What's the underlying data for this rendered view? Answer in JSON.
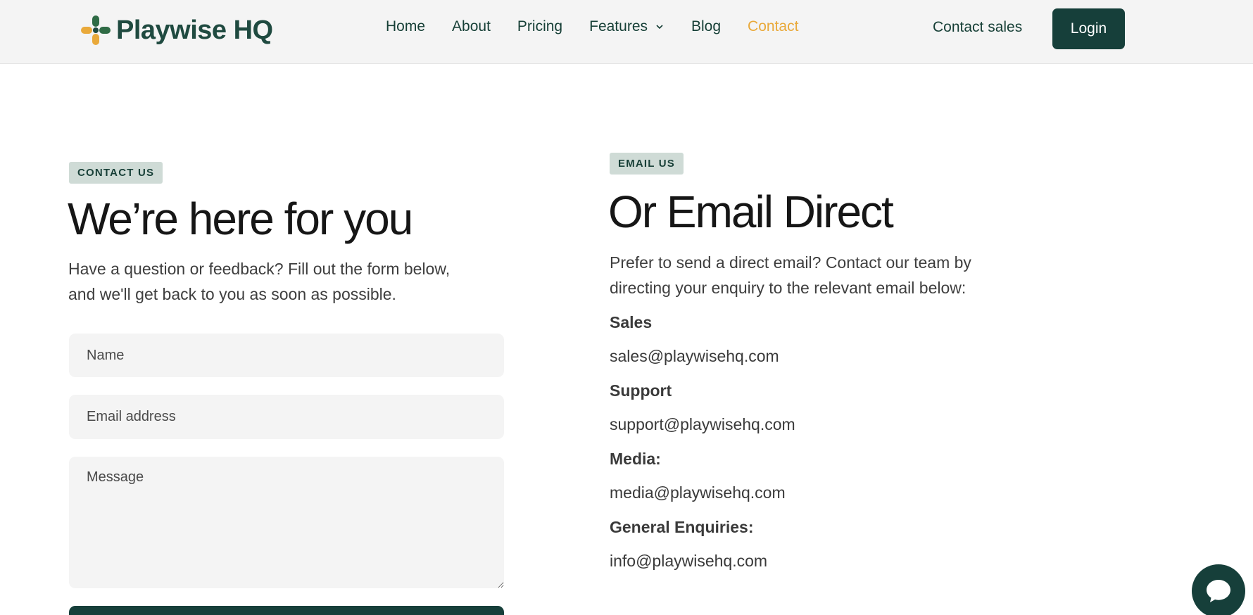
{
  "brand": {
    "name": "Playwise HQ"
  },
  "nav": {
    "items": [
      {
        "label": "Home"
      },
      {
        "label": "About"
      },
      {
        "label": "Pricing"
      },
      {
        "label": "Features"
      },
      {
        "label": "Blog"
      },
      {
        "label": "Contact"
      }
    ],
    "active": "Contact",
    "contact_sales": "Contact sales",
    "login": "Login"
  },
  "contact_form": {
    "badge": "CONTACT US",
    "title": "We’re here for you",
    "subtitle": "Have a question or feedback? Fill out the form below, and we'll get back to you as soon as possible.",
    "name_placeholder": "Name",
    "email_placeholder": "Email address",
    "message_placeholder": "Message"
  },
  "email_direct": {
    "badge": "EMAIL US",
    "title": "Or Email Direct",
    "subtitle": "Prefer to send a direct email? Contact our team by directing your enquiry to the relevant email below:",
    "contacts": [
      {
        "label": "Sales",
        "email": "sales@playwisehq.com"
      },
      {
        "label": "Support",
        "email": "support@playwisehq.com"
      },
      {
        "label": "Media:",
        "email": "media@playwisehq.com"
      },
      {
        "label": "General Enquiries:",
        "email": "info@playwisehq.com"
      }
    ]
  },
  "colors": {
    "brand_dark": "#163f3a",
    "accent": "#e9a93a",
    "badge_bg": "#cfdbd6",
    "field_bg": "#f4f4f4"
  },
  "icons": [
    "playwise-logo-icon",
    "chevron-down-icon",
    "chat-icon"
  ]
}
